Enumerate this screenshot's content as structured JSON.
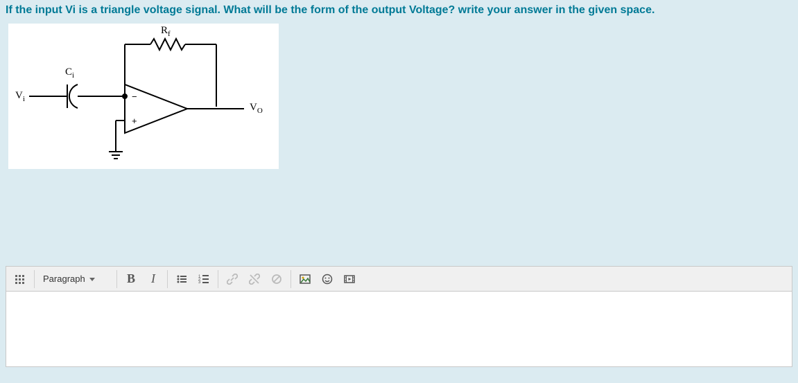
{
  "question": {
    "prompt": "If the input Vi is a triangle voltage signal. What will be the form of the output Voltage? write your answer in the given space."
  },
  "circuit_labels": {
    "rf": "R",
    "rf_sub": "f",
    "ci": "C",
    "ci_sub": "i",
    "vi": "V",
    "vi_sub": "i",
    "vo": "V",
    "vo_sub": "O",
    "minus": "−",
    "plus": "+"
  },
  "toolbar": {
    "toggle_toolbar": "Toggle toolbar",
    "format_label": "Paragraph",
    "bold": "B",
    "italic": "I",
    "bullet_list": "Bullet list",
    "number_list": "Number list",
    "link": "Link",
    "unlink": "Unlink",
    "nolink": "Prevent link",
    "image": "Image",
    "emoji": "Emoji",
    "media": "Media"
  },
  "editor": {
    "content": ""
  }
}
